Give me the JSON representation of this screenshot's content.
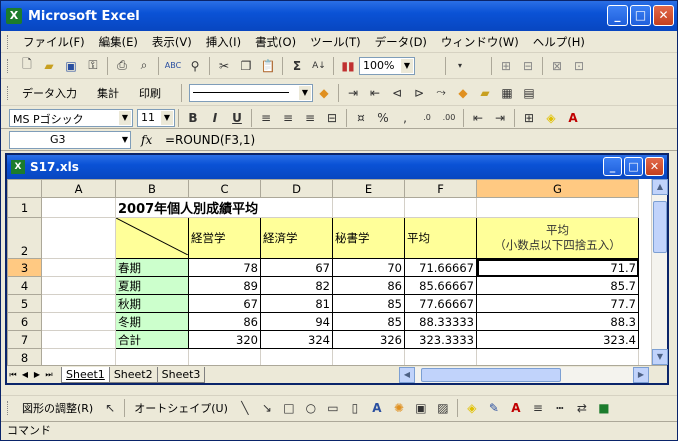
{
  "app": {
    "title": "Microsoft Excel"
  },
  "menu": [
    "ファイル(F)",
    "編集(E)",
    "表示(V)",
    "挿入(I)",
    "書式(O)",
    "ツール(T)",
    "データ(D)",
    "ウィンドウ(W)",
    "ヘルプ(H)"
  ],
  "toolbar1": {
    "sum_symbol": "Σ",
    "zoom": "100%"
  },
  "toolbar2": {
    "btn_data_input": "データ入力",
    "btn_aggregate": "集計",
    "btn_print": "印刷",
    "font_name": "MS Pゴシック",
    "font_size": "11",
    "bold": "B",
    "italic": "I",
    "underline": "U"
  },
  "formula_bar": {
    "name_box": "G3",
    "fx": "fx",
    "formula": "=ROUND(F3,1)"
  },
  "workbook": {
    "title": "S17.xls"
  },
  "sheet": {
    "columns": [
      "A",
      "B",
      "C",
      "D",
      "E",
      "F",
      "G"
    ],
    "row_numbers": [
      "1",
      "2",
      "3",
      "4",
      "5",
      "6",
      "7",
      "8"
    ],
    "title": "2007年個人別成績平均",
    "headers": [
      "経営学",
      "経済学",
      "秘書学",
      "平均",
      "平均",
      "（小数点以下四捨五入）"
    ],
    "rows": [
      {
        "label": "春期",
        "c": "78",
        "d": "67",
        "e": "70",
        "f": "71.66667",
        "g": "71.7"
      },
      {
        "label": "夏期",
        "c": "89",
        "d": "82",
        "e": "86",
        "f": "85.66667",
        "g": "85.7"
      },
      {
        "label": "秋期",
        "c": "67",
        "d": "81",
        "e": "85",
        "f": "77.66667",
        "g": "77.7"
      },
      {
        "label": "冬期",
        "c": "86",
        "d": "94",
        "e": "85",
        "f": "88.33333",
        "g": "88.3"
      },
      {
        "label": "合計",
        "c": "320",
        "d": "324",
        "e": "326",
        "f": "323.3333",
        "g": "323.4"
      }
    ]
  },
  "tabs": [
    "Sheet1",
    "Sheet2",
    "Sheet3"
  ],
  "drawbar": {
    "adjust": "図形の調整(R)",
    "autoshape": "オートシェイプ(U)"
  },
  "status": "コマンド",
  "colors": {
    "selection_header": "#ffc982",
    "header_fill": "#ffff99",
    "label_fill": "#ccffcc"
  }
}
